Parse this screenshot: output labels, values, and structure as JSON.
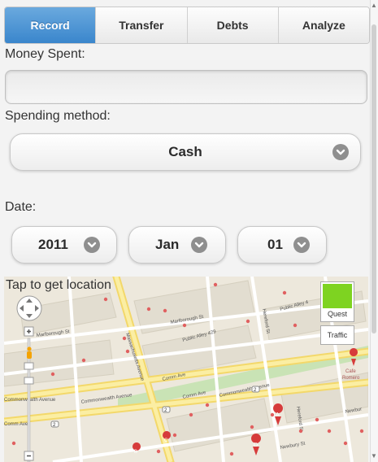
{
  "tabs": [
    {
      "label": "Record",
      "active": true
    },
    {
      "label": "Transfer",
      "active": false
    },
    {
      "label": "Debts",
      "active": false
    },
    {
      "label": "Analyze",
      "active": false
    }
  ],
  "form": {
    "money_label": "Money Spent:",
    "money_value": "",
    "method_label": "Spending method:",
    "method_value": "Cash",
    "date_label": "Date:",
    "year": "2011",
    "month": "Jan",
    "day": "01"
  },
  "map": {
    "tap_label": "Tap to get location",
    "layer_quest": "Quest",
    "layer_traffic": "Traffic",
    "streets": [
      "Marlborough St",
      "Public Alley 429",
      "Comm Ave",
      "Commonwealth Avenue",
      "Massachusetts Avenue",
      "Hereford St",
      "Newbury St",
      "Public Alley 4",
      "Cafe Romero",
      "Newbur"
    ]
  },
  "colors": {
    "tab_active": "#3a86cc",
    "quest_swatch": "#7ed321",
    "road_yellow": "#f7e27a"
  }
}
